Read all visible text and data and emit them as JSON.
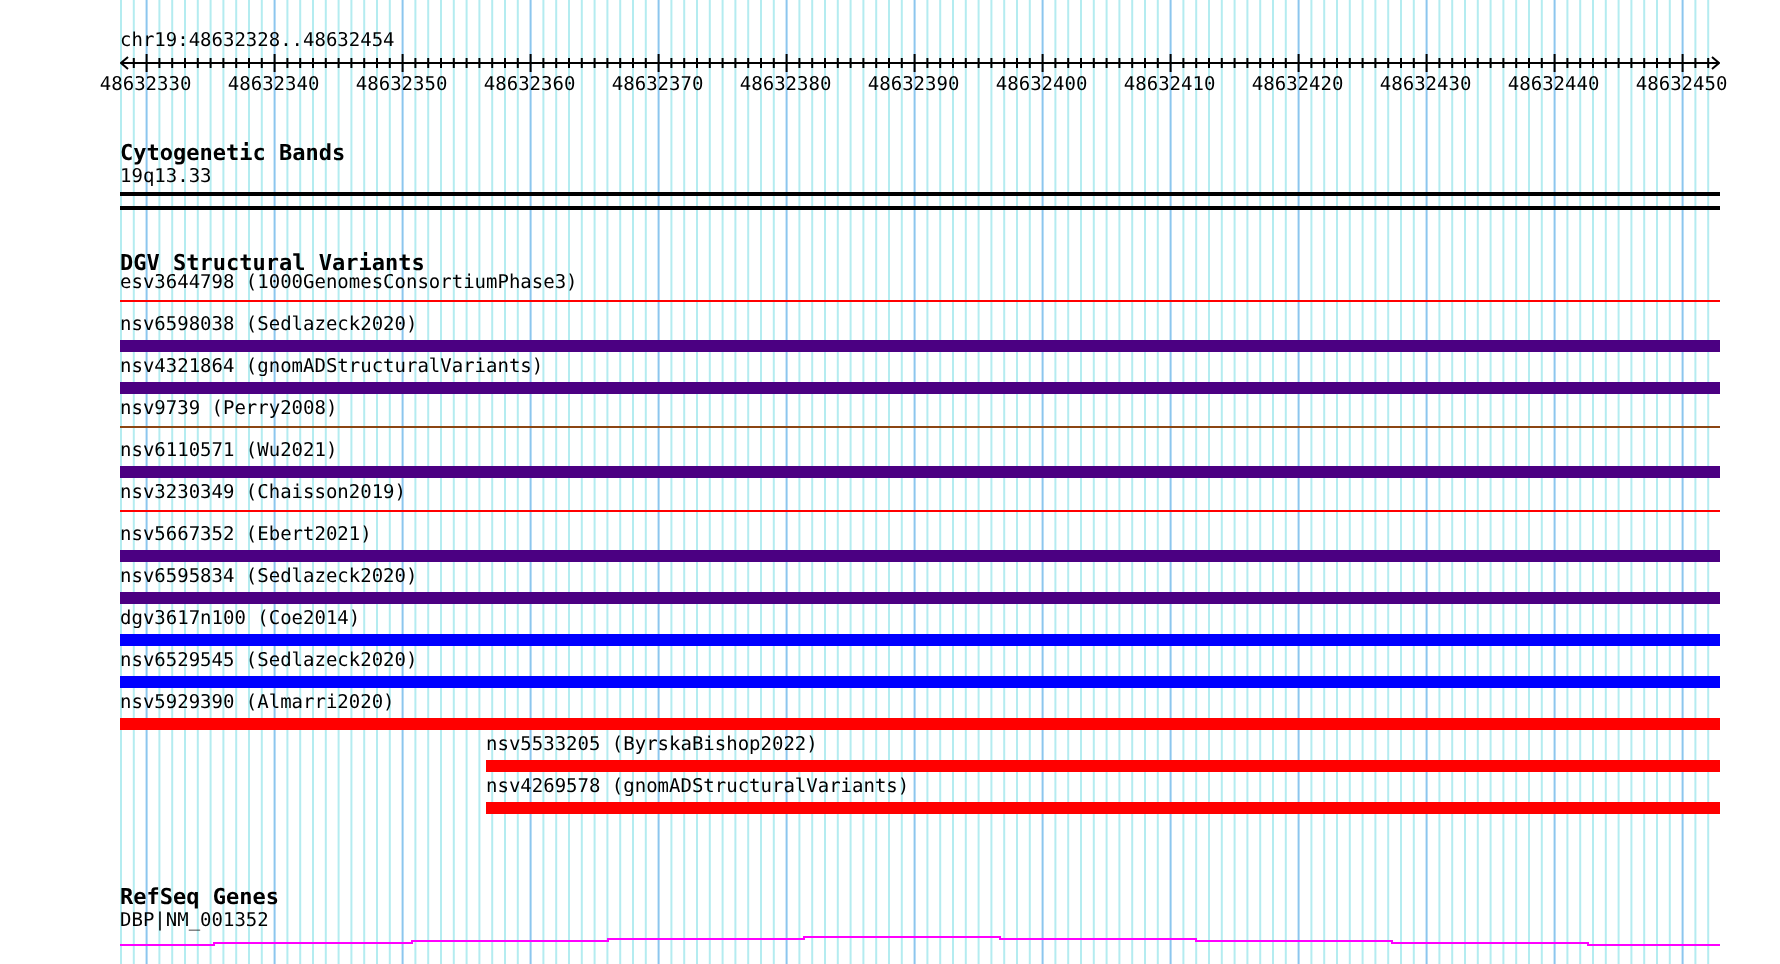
{
  "location": "chr19:48632328..48632454",
  "ruler": {
    "ticks": [
      "48632330",
      "48632340",
      "48632350",
      "48632360",
      "48632370",
      "48632380",
      "48632390",
      "48632400",
      "48632410",
      "48632420",
      "48632430",
      "48632440",
      "48632450"
    ]
  },
  "tracks": [
    {
      "kind": "band",
      "title": "Cytogenetic Bands",
      "features": [
        {
          "label": "19q13.33"
        }
      ]
    },
    {
      "kind": "variants",
      "title": "DGV Structural Variants",
      "features": [
        {
          "label": "esv3644798 (1000GenomesConsortiumPhase3)",
          "kind": "thin",
          "color": "#ff0000",
          "starts_in_view": false
        },
        {
          "label": "nsv6598038 (Sedlazeck2020)",
          "kind": "thick",
          "color": "#4b0082",
          "starts_in_view": false
        },
        {
          "label": "nsv4321864 (gnomADStructuralVariants)",
          "kind": "thick",
          "color": "#4b0082",
          "starts_in_view": false
        },
        {
          "label": "nsv9739 (Perry2008)",
          "kind": "thin",
          "color": "#8b4513",
          "starts_in_view": false
        },
        {
          "label": "nsv6110571 (Wu2021)",
          "kind": "thick",
          "color": "#4b0082",
          "starts_in_view": false
        },
        {
          "label": "nsv3230349 (Chaisson2019)",
          "kind": "thin",
          "color": "#ff0000",
          "starts_in_view": false
        },
        {
          "label": "nsv5667352 (Ebert2021)",
          "kind": "thick",
          "color": "#4b0082",
          "starts_in_view": false
        },
        {
          "label": "nsv6595834 (Sedlazeck2020)",
          "kind": "thick",
          "color": "#4b0082",
          "starts_in_view": false
        },
        {
          "label": "dgv3617n100 (Coe2014)",
          "kind": "thick",
          "color": "#0000ff",
          "starts_in_view": false
        },
        {
          "label": "nsv6529545 (Sedlazeck2020)",
          "kind": "thick",
          "color": "#0000ff",
          "starts_in_view": false
        },
        {
          "label": "nsv5929390 (Almarri2020)",
          "kind": "thick",
          "color": "#ff0000",
          "starts_in_view": false
        },
        {
          "label": "nsv5533205 (ByrskaBishop2022)",
          "kind": "thick",
          "color": "#ff0000",
          "starts_in_view": true
        },
        {
          "label": "nsv4269578 (gnomADStructuralVariants)",
          "kind": "thick",
          "color": "#ff0000",
          "starts_in_view": true
        }
      ]
    },
    {
      "kind": "genes",
      "title": "RefSeq Genes",
      "features": [
        {
          "label": "DBP|NM_001352"
        }
      ]
    }
  ]
}
